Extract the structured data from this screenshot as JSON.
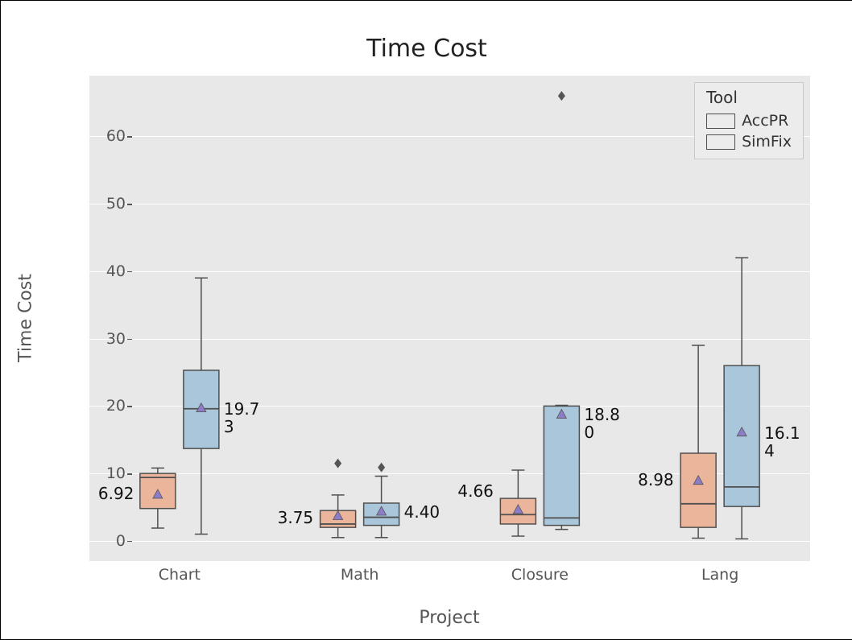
{
  "title": "Time Cost",
  "ylabel": "Time Cost",
  "xlabel": "Project",
  "legend": {
    "title": "Tool",
    "items": [
      {
        "name": "AccPR"
      },
      {
        "name": "SimFix"
      }
    ]
  },
  "yticks": [
    0,
    10,
    20,
    30,
    40,
    50,
    60
  ],
  "categories": [
    "Chart",
    "Math",
    "Closure",
    "Lang"
  ],
  "annotations": {
    "chart_acc": "6.92",
    "chart_sim_a": "19.7",
    "chart_sim_b": "3",
    "math_acc": "3.75",
    "math_sim": "4.40",
    "closure_acc": "4.66",
    "closure_sim_a": "18.8",
    "closure_sim_b": "0",
    "lang_acc": "8.98",
    "lang_sim_a": "16.1",
    "lang_sim_b": "4"
  },
  "chart_data": {
    "type": "box",
    "xlabel": "Project",
    "ylabel": "Time Cost",
    "title": "Time Cost",
    "ylim": [
      -3,
      69
    ],
    "categories": [
      "Chart",
      "Math",
      "Closure",
      "Lang"
    ],
    "series": [
      {
        "name": "AccPR",
        "color": "#eab59b",
        "boxes": [
          {
            "category": "Chart",
            "min": 1.9,
            "q1": 4.8,
            "median": 9.4,
            "q3": 10.0,
            "max": 10.8,
            "mean": 6.92,
            "outliers": []
          },
          {
            "category": "Math",
            "min": 0.5,
            "q1": 2.0,
            "median": 2.5,
            "q3": 4.5,
            "max": 6.8,
            "mean": 3.75,
            "outliers": [
              11.5
            ]
          },
          {
            "category": "Closure",
            "min": 0.7,
            "q1": 2.5,
            "median": 3.9,
            "q3": 6.3,
            "max": 10.5,
            "mean": 4.66,
            "outliers": []
          },
          {
            "category": "Lang",
            "min": 0.4,
            "q1": 2.0,
            "median": 5.5,
            "q3": 13.0,
            "max": 29.0,
            "mean": 8.98,
            "outliers": []
          }
        ]
      },
      {
        "name": "SimFix",
        "color": "#a9c6da",
        "boxes": [
          {
            "category": "Chart",
            "min": 1.0,
            "q1": 13.7,
            "median": 19.6,
            "q3": 25.3,
            "max": 39.0,
            "mean": 19.73,
            "outliers": []
          },
          {
            "category": "Math",
            "min": 0.5,
            "q1": 2.3,
            "median": 3.5,
            "q3": 5.6,
            "max": 9.6,
            "mean": 4.4,
            "outliers": [
              10.9
            ]
          },
          {
            "category": "Closure",
            "min": 1.7,
            "q1": 2.3,
            "median": 3.4,
            "q3": 20.0,
            "max": 20.1,
            "mean": 18.8,
            "outliers": [
              66.0
            ]
          },
          {
            "category": "Lang",
            "min": 0.3,
            "q1": 5.1,
            "median": 8.0,
            "q3": 26.0,
            "max": 42.0,
            "mean": 16.14,
            "outliers": []
          }
        ]
      }
    ]
  }
}
